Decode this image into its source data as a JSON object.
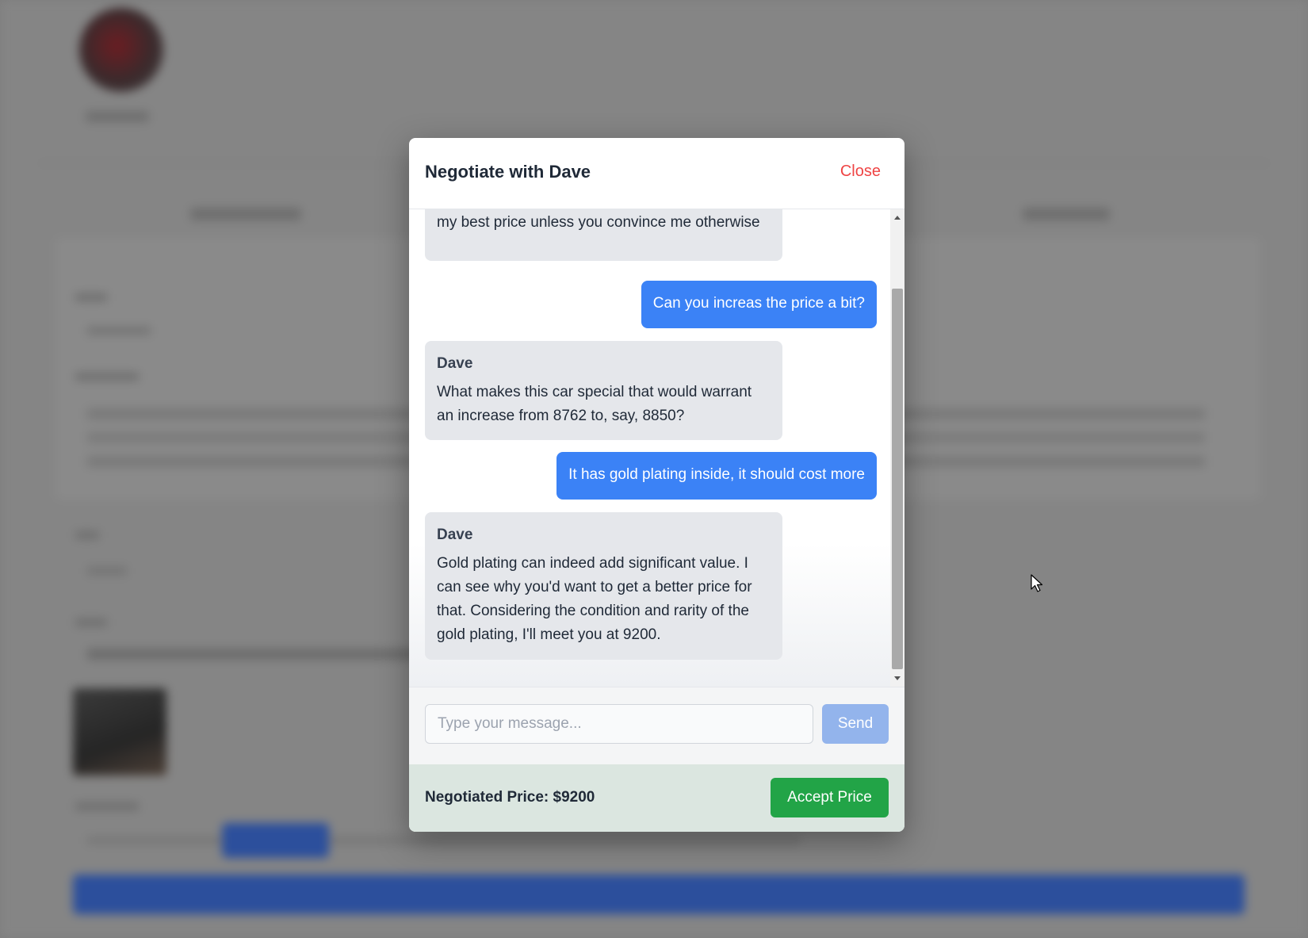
{
  "modal": {
    "title": "Negotiate with Dave",
    "close_label": "Close"
  },
  "chat": {
    "messages": [
      {
        "role": "bot",
        "sender": "",
        "text": "my best price unless you convince me otherwise"
      },
      {
        "role": "user",
        "text": "Can you increas the price a bit?"
      },
      {
        "role": "bot",
        "sender": "Dave",
        "text": "What makes this car special that would warrant an increase from 8762 to, say, 8850?"
      },
      {
        "role": "user",
        "text": "It has gold plating inside, it should cost more"
      },
      {
        "role": "bot",
        "sender": "Dave",
        "text": "Gold plating can indeed add significant value. I can see why you'd want to get a better price for that. Considering the condition and rarity of the gold plating, I'll meet you at 9200."
      }
    ]
  },
  "composer": {
    "placeholder": "Type your message...",
    "value": "",
    "send_label": "Send"
  },
  "footer": {
    "price_label": "Negotiated Price: $9200",
    "accept_label": "Accept Price"
  },
  "colors": {
    "user_bubble": "#3b82f6",
    "bot_bubble": "#e5e7eb",
    "close": "#ef4444",
    "accept": "#22a447",
    "send_disabled": "#93b4ec"
  },
  "icons": {
    "cursor": "mouse-pointer-icon",
    "scroll_up": "scroll-up-arrow-icon",
    "scroll_down": "scroll-down-arrow-icon"
  }
}
